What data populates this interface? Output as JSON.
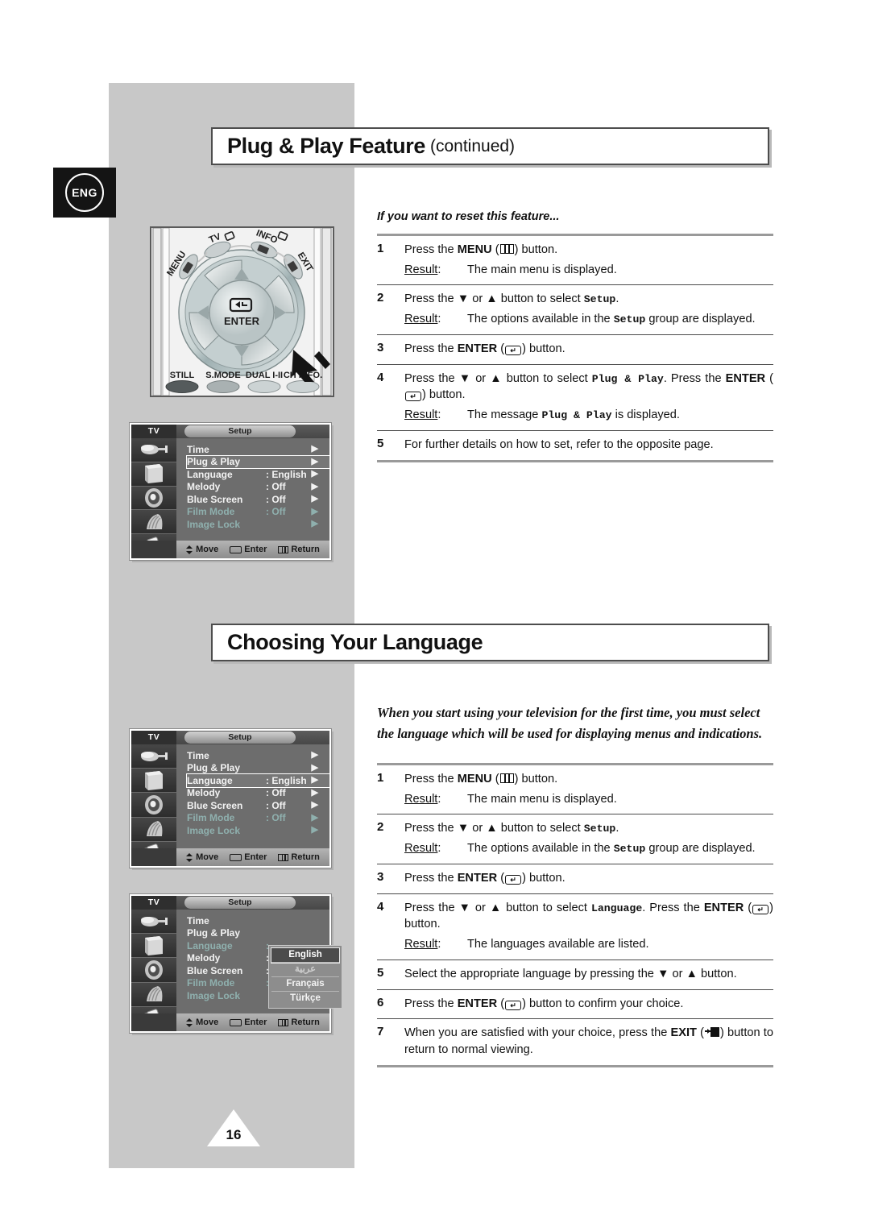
{
  "page": {
    "number": "16",
    "language_badge": "ENG"
  },
  "sections": [
    {
      "title": "Plug & Play Feature",
      "title_suffix": "(continued)",
      "intro": "If you want to reset this feature...",
      "steps": [
        {
          "num": "1",
          "parts": [
            {
              "t": "Press the "
            },
            {
              "t": "MENU",
              "s": "b"
            },
            {
              "t": " ("
            },
            {
              "t": "",
              "s": "icon-menu"
            },
            {
              "t": ") button."
            }
          ],
          "result_label": "Result:",
          "result_parts": [
            {
              "t": "The main menu is displayed."
            }
          ]
        },
        {
          "num": "2",
          "parts": [
            {
              "t": "Press the ▼ or ▲ button to select "
            },
            {
              "t": "Setup",
              "s": "mono"
            },
            {
              "t": "."
            }
          ],
          "result_label": "Result:",
          "result_parts": [
            {
              "t": "The options available in the "
            },
            {
              "t": "Setup",
              "s": "mono"
            },
            {
              "t": " group are displayed."
            }
          ]
        },
        {
          "num": "3",
          "parts": [
            {
              "t": "Press the "
            },
            {
              "t": "ENTER",
              "s": "b"
            },
            {
              "t": " ("
            },
            {
              "t": "",
              "s": "icon-enter"
            },
            {
              "t": ") button."
            }
          ]
        },
        {
          "num": "4",
          "justify": true,
          "parts": [
            {
              "t": "Press the ▼ or ▲ button to select "
            },
            {
              "t": "Plug & Play",
              "s": "mono"
            },
            {
              "t": ". Press the "
            },
            {
              "t": "ENTER",
              "s": "b"
            },
            {
              "t": " ("
            },
            {
              "t": "",
              "s": "icon-enter"
            },
            {
              "t": ") button."
            }
          ],
          "result_label": "Result:",
          "result_parts": [
            {
              "t": "The message "
            },
            {
              "t": "Plug & Play",
              "s": "mono"
            },
            {
              "t": " is displayed."
            }
          ]
        },
        {
          "num": "5",
          "parts": [
            {
              "t": "For further details on how to set, refer to the opposite page."
            }
          ]
        }
      ]
    },
    {
      "title": "Choosing Your Language",
      "title_suffix": "",
      "intro": "When you start using your television for the first time, you must select the language which will be used for displaying menus and indications.",
      "steps": [
        {
          "num": "1",
          "parts": [
            {
              "t": "Press the "
            },
            {
              "t": "MENU",
              "s": "b"
            },
            {
              "t": " ("
            },
            {
              "t": "",
              "s": "icon-menu"
            },
            {
              "t": ") button."
            }
          ],
          "result_label": "Result:",
          "result_parts": [
            {
              "t": "The main menu is displayed."
            }
          ]
        },
        {
          "num": "2",
          "parts": [
            {
              "t": "Press the ▼ or ▲ button to select "
            },
            {
              "t": "Setup",
              "s": "mono"
            },
            {
              "t": "."
            }
          ],
          "result_label": "Result:",
          "result_parts": [
            {
              "t": "The options available in the "
            },
            {
              "t": "Setup",
              "s": "mono"
            },
            {
              "t": " group are displayed."
            }
          ]
        },
        {
          "num": "3",
          "parts": [
            {
              "t": "Press the "
            },
            {
              "t": "ENTER",
              "s": "b"
            },
            {
              "t": " ("
            },
            {
              "t": "",
              "s": "icon-enter"
            },
            {
              "t": ") button."
            }
          ]
        },
        {
          "num": "4",
          "justify": true,
          "parts": [
            {
              "t": "Press the ▼ or ▲ button to select "
            },
            {
              "t": "Language",
              "s": "mono"
            },
            {
              "t": ". Press the "
            },
            {
              "t": "ENTER",
              "s": "b"
            },
            {
              "t": " ("
            },
            {
              "t": "",
              "s": "icon-enter"
            },
            {
              "t": ") button."
            }
          ],
          "result_label": "Result:",
          "result_parts": [
            {
              "t": "The languages available are listed."
            }
          ]
        },
        {
          "num": "5",
          "parts": [
            {
              "t": "Select the appropriate language by pressing the ▼ or ▲ button."
            }
          ]
        },
        {
          "num": "6",
          "parts": [
            {
              "t": "Press the "
            },
            {
              "t": "ENTER",
              "s": "b"
            },
            {
              "t": " ("
            },
            {
              "t": "",
              "s": "icon-enter"
            },
            {
              "t": ") button to confirm your choice."
            }
          ]
        },
        {
          "num": "7",
          "justify": true,
          "parts": [
            {
              "t": "When you are satisfied with your choice, press the "
            },
            {
              "t": "EXIT",
              "s": "b"
            },
            {
              "t": " ("
            },
            {
              "t": "",
              "s": "icon-exit"
            },
            {
              "t": ") button to return to normal viewing."
            }
          ]
        }
      ]
    }
  ],
  "remote": {
    "top_buttons": [
      "MENU",
      "TV",
      "INFO",
      "EXIT"
    ],
    "center_label": "ENTER",
    "bottom_buttons": [
      "STILL",
      "S.MODE",
      "DUAL I-II",
      "CH INFO."
    ]
  },
  "osd": {
    "tv_label": "TV",
    "setup_tab": "Setup",
    "bottom_bar": [
      "Move",
      "Enter",
      "Return"
    ],
    "icons": [
      "plug-icon",
      "picture-icon",
      "sound-icon",
      "channel-icon",
      "setup-icon"
    ],
    "menus": [
      {
        "selected": "Plug & Play",
        "rows": [
          {
            "name": "Time",
            "value": "",
            "arrow": true,
            "dim": false
          },
          {
            "name": "Plug & Play",
            "value": "",
            "arrow": true,
            "dim": false
          },
          {
            "name": "Language",
            "value": ": English",
            "arrow": true,
            "dim": false
          },
          {
            "name": "Melody",
            "value": ": Off",
            "arrow": true,
            "dim": false
          },
          {
            "name": "Blue Screen",
            "value": ": Off",
            "arrow": true,
            "dim": false
          },
          {
            "name": "Film Mode",
            "value": ": Off",
            "arrow": true,
            "dim": true
          },
          {
            "name": "Image Lock",
            "value": "",
            "arrow": true,
            "dim": true
          }
        ]
      },
      {
        "selected": "Language",
        "rows": [
          {
            "name": "Time",
            "value": "",
            "arrow": true,
            "dim": false
          },
          {
            "name": "Plug & Play",
            "value": "",
            "arrow": true,
            "dim": false
          },
          {
            "name": "Language",
            "value": ": English",
            "arrow": true,
            "dim": false
          },
          {
            "name": "Melody",
            "value": ": Off",
            "arrow": true,
            "dim": false
          },
          {
            "name": "Blue Screen",
            "value": ": Off",
            "arrow": true,
            "dim": false
          },
          {
            "name": "Film Mode",
            "value": ": Off",
            "arrow": true,
            "dim": true
          },
          {
            "name": "Image Lock",
            "value": "",
            "arrow": true,
            "dim": true
          }
        ]
      },
      {
        "selected": "",
        "rows": [
          {
            "name": "Time",
            "value": "",
            "arrow": false,
            "dim": false
          },
          {
            "name": "Plug & Play",
            "value": "",
            "arrow": false,
            "dim": false
          },
          {
            "name": "Language",
            "value": ":",
            "arrow": false,
            "dim": true
          },
          {
            "name": "Melody",
            "value": ":",
            "arrow": false,
            "dim": false
          },
          {
            "name": "Blue Screen",
            "value": ":",
            "arrow": false,
            "dim": false
          },
          {
            "name": "Film Mode",
            "value": ":",
            "arrow": false,
            "dim": true
          },
          {
            "name": "Image Lock",
            "value": "",
            "arrow": false,
            "dim": true
          }
        ],
        "language_options": [
          {
            "label": "English",
            "selected": true,
            "arabic": false
          },
          {
            "label": "عربية",
            "selected": false,
            "arabic": true
          },
          {
            "label": "Français",
            "selected": false,
            "arabic": false
          },
          {
            "label": "Türkçe",
            "selected": false,
            "arabic": false
          }
        ]
      }
    ]
  },
  "colors": {
    "sidebar_gray": "#c8c8c8",
    "rule_gray": "#9a9a9a",
    "osd_bg": "#6d6d6d",
    "badge_black": "#141414"
  }
}
